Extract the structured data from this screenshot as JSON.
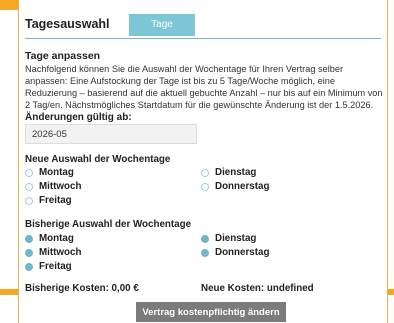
{
  "header": {
    "title": "Tagesauswahl",
    "tab_label": "Tage anpassen"
  },
  "section": {
    "title": "Tage anpassen",
    "description": "Nachfolgend können Sie die Auswahl der Wochentage für Ihren Vertrag selber anpassen: Eine Aufstockung der Tage ist bis zu 5 Tage/Woche möglich, eine Reduzierung – basierend auf die aktuell gebuchte Anzahl – nur bis auf ein Minimum von 2 Tag/en. Nächstmögliches Startdatum für die gewünschte Änderung ist der 1.5.2026."
  },
  "date_field": {
    "label": "Änderungen gültig ab:",
    "value": "2026-05"
  },
  "new_selection": {
    "title": "Neue Auswahl der Wochentage",
    "days": [
      {
        "label": "Montag",
        "selected": false
      },
      {
        "label": "Dienstag",
        "selected": false
      },
      {
        "label": "Mittwoch",
        "selected": false
      },
      {
        "label": "Donnerstag",
        "selected": false
      },
      {
        "label": "Freitag",
        "selected": false
      }
    ]
  },
  "previous_selection": {
    "title": "Bisherige Auswahl der Wochentage",
    "days": [
      {
        "label": "Montag",
        "selected": true
      },
      {
        "label": "Dienstag",
        "selected": true
      },
      {
        "label": "Mittwoch",
        "selected": true
      },
      {
        "label": "Donnerstag",
        "selected": true
      },
      {
        "label": "Freitag",
        "selected": true
      }
    ]
  },
  "costs": {
    "previous": "Bisherige Kosten: 0,00 €",
    "new": "Neue Kosten: undefined"
  },
  "submit_label": "Vertrag kostenpflichtig ändern",
  "colors": {
    "accent": "#f5a623",
    "teal": "#7cc6d6",
    "button": "#7b7b7b"
  }
}
